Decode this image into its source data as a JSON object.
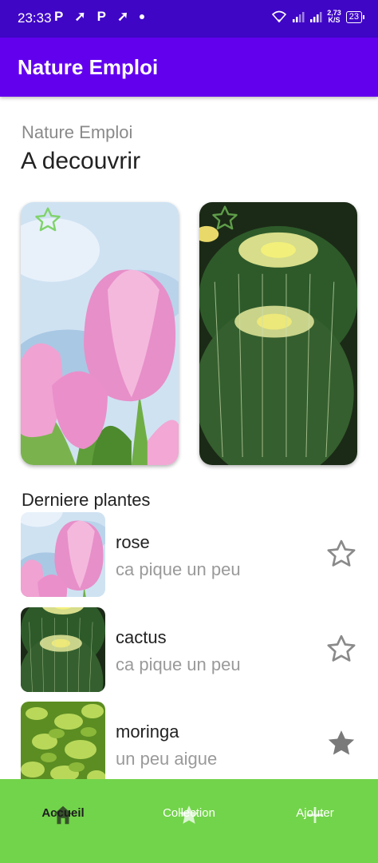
{
  "status_bar": {
    "time": "23:33",
    "notification_icons": [
      "P",
      "➚",
      "P",
      "➚"
    ],
    "network_speed_value": "2,73",
    "network_speed_unit": "K/S",
    "battery": "23",
    "icons": [
      "wifi-icon",
      "signal-icon",
      "signal-icon"
    ]
  },
  "app_bar": {
    "title": "Nature Emploi"
  },
  "header": {
    "subtitle": "Nature Emploi",
    "title": "A decouvrir"
  },
  "featured": [
    {
      "image": "pink-tulips",
      "favorite": false
    },
    {
      "image": "barrel-cactus",
      "favorite": false
    }
  ],
  "list": {
    "title": "Derniere plantes",
    "items": [
      {
        "name": "rose",
        "description": "ca pique un peu",
        "image": "pink-tulips",
        "favorite": false
      },
      {
        "name": "cactus",
        "description": "ca pique un peu",
        "image": "barrel-cactus",
        "favorite": false
      },
      {
        "name": "moringa",
        "description": "un peu aigue",
        "image": "moringa-leaves",
        "favorite": true
      }
    ]
  },
  "bottom_nav": {
    "items": [
      {
        "label": "Accueil",
        "icon": "home-icon",
        "active": true
      },
      {
        "label": "Collection",
        "icon": "star-icon",
        "active": false
      },
      {
        "label": "Ajouter",
        "icon": "plus-icon",
        "active": false
      }
    ]
  },
  "colors": {
    "status_bar": "#3f06c6",
    "app_bar": "#6200ee",
    "bottom_nav": "#72d44a",
    "accent_star_featured": "#7fd36a"
  }
}
